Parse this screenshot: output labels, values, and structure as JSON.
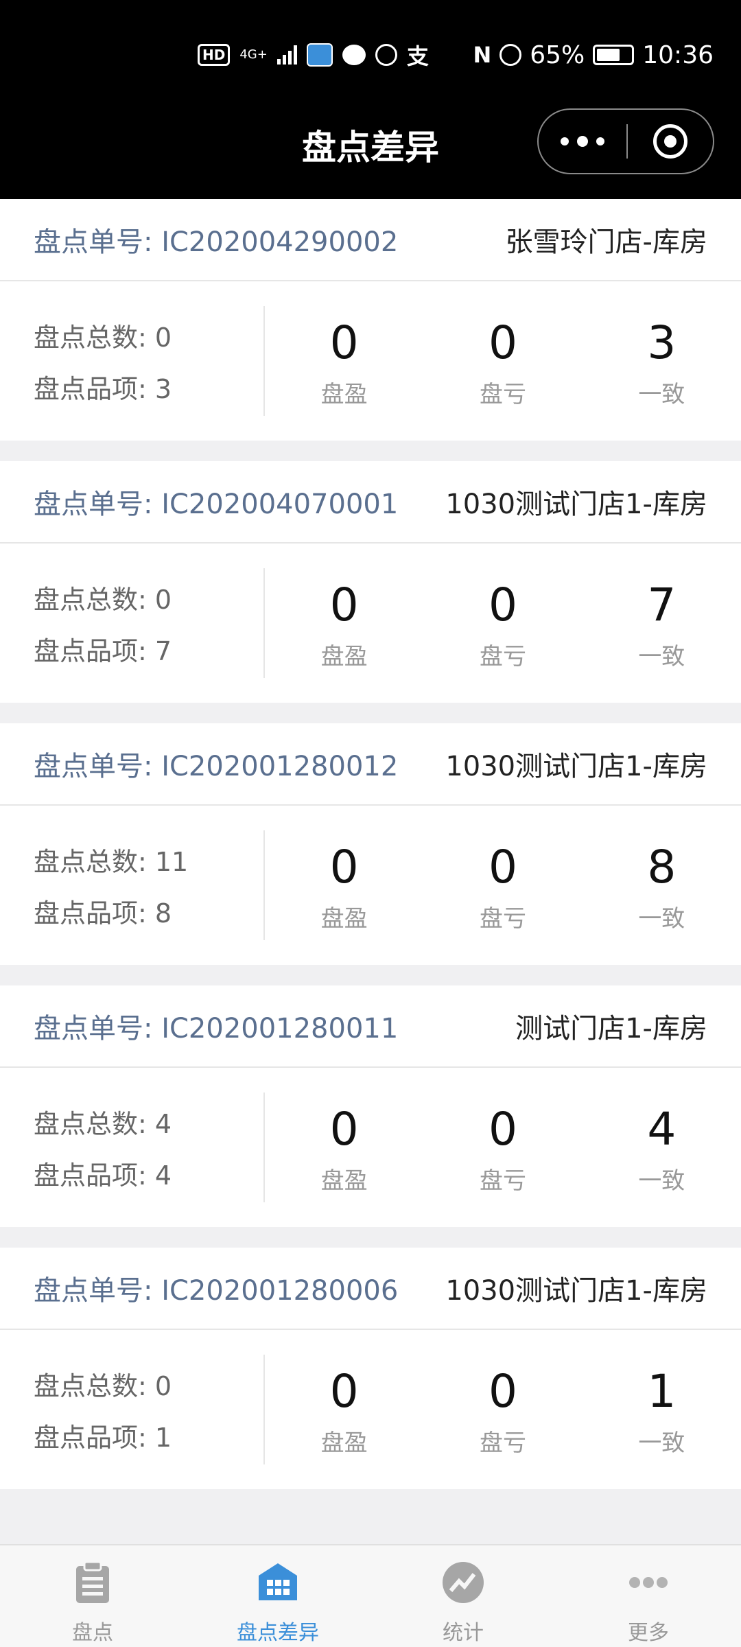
{
  "status_bar": {
    "net_type": "4G+",
    "battery_percent": "65%",
    "time": "10:36",
    "icons": [
      "hd-icon",
      "signal-icon",
      "app-notification-icon",
      "chat-icon",
      "hand-icon",
      "alipay-icon",
      "nfc-icon",
      "alarm-icon",
      "battery-icon"
    ]
  },
  "header": {
    "title": "盘点差异"
  },
  "records": [
    {
      "order_label": "盘点单号: IC202004290002",
      "store": "张雪玲门店-库房",
      "total": "盘点总数: 0",
      "items": "盘点品项: 3",
      "surplus": "0",
      "loss": "0",
      "match": "3"
    },
    {
      "order_label": "盘点单号: IC202004070001",
      "store": "1030测试门店1-库房",
      "total": "盘点总数: 0",
      "items": "盘点品项: 7",
      "surplus": "0",
      "loss": "0",
      "match": "7"
    },
    {
      "order_label": "盘点单号: IC202001280012",
      "store": "1030测试门店1-库房",
      "total": "盘点总数: 11",
      "items": "盘点品项: 8",
      "surplus": "0",
      "loss": "0",
      "match": "8"
    },
    {
      "order_label": "盘点单号: IC202001280011",
      "store": "测试门店1-库房",
      "total": "盘点总数: 4",
      "items": "盘点品项: 4",
      "surplus": "0",
      "loss": "0",
      "match": "4"
    },
    {
      "order_label": "盘点单号: IC202001280006",
      "store": "1030测试门店1-库房",
      "total": "盘点总数: 0",
      "items": "盘点品项: 1",
      "surplus": "0",
      "loss": "0",
      "match": "1"
    }
  ],
  "metric_labels": {
    "surplus": "盘盈",
    "loss": "盘亏",
    "match": "一致"
  },
  "tabbar": {
    "items": [
      {
        "label": "盘点",
        "icon": "clipboard-icon",
        "active": false
      },
      {
        "label": "盘点差异",
        "icon": "grid-icon",
        "active": true
      },
      {
        "label": "统计",
        "icon": "chart-icon",
        "active": false
      },
      {
        "label": "更多",
        "icon": "more-dots-icon",
        "active": false
      }
    ]
  },
  "colors": {
    "accent": "#3b8fd9",
    "order_text": "#5a6f8f",
    "inactive": "#999999"
  }
}
